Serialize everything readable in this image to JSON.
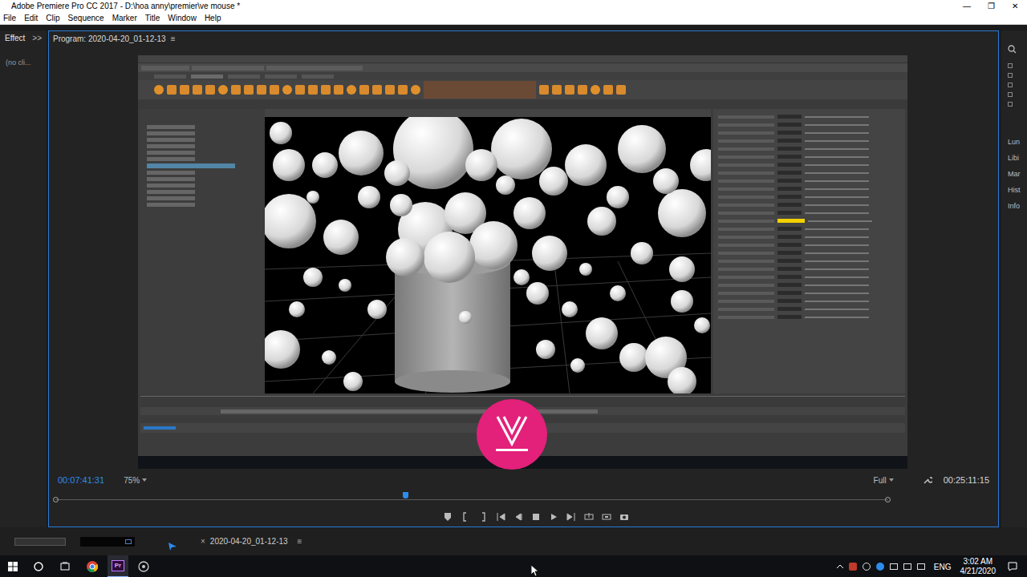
{
  "window": {
    "title": "Adobe Premiere Pro CC 2017 - D:\\hoa anny\\premier\\ve mouse *",
    "controls": [
      "—",
      "❐",
      "✕"
    ]
  },
  "menu": [
    "File",
    "Edit",
    "Clip",
    "Sequence",
    "Marker",
    "Title",
    "Window",
    "Help"
  ],
  "left_panel": {
    "tab": "Effect",
    "more": ">>",
    "content": "(no cli..."
  },
  "program": {
    "title": "Program: 2020-04-20_01-12-13",
    "menu": "≡",
    "timecode": "00:07:41:31",
    "zoom": "75%",
    "quality": "Full",
    "duration": "00:25:11:15",
    "playhead": {
      "level": 0.42
    }
  },
  "right_panel": [
    "Lun",
    "Libi",
    "Mar",
    "Hist",
    "Info"
  ],
  "timeline": {
    "close": "×",
    "tab": "2020-04-20_01-12-13",
    "menu": "≡"
  },
  "taskbar": {
    "apps": [
      "Pr"
    ],
    "lang": "ENG",
    "time": "3:02 AM",
    "date": "4/21/2020"
  }
}
